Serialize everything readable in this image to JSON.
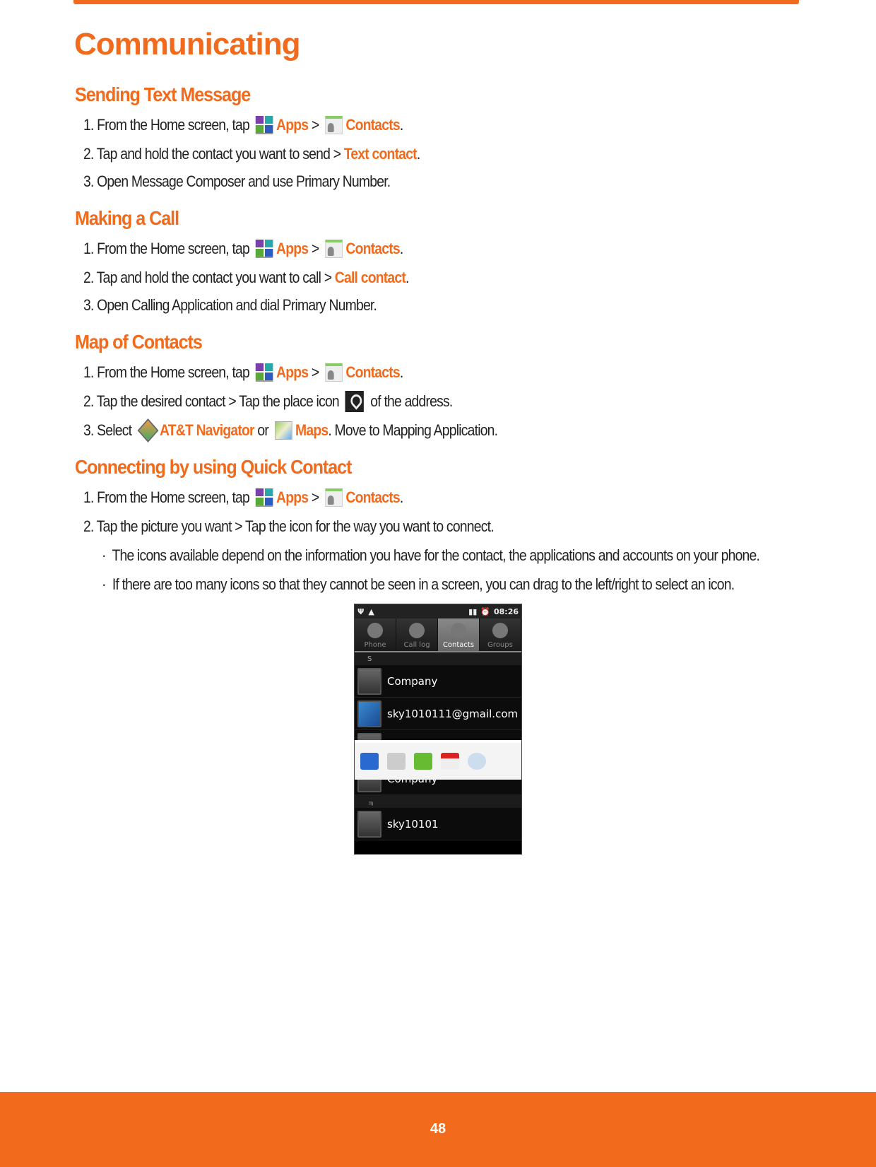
{
  "title": "Communicating",
  "sections": [
    {
      "heading": "Sending Text Message",
      "items": [
        [
          {
            "t": "1. From the Home screen, tap "
          },
          {
            "icon": "apps-icon"
          },
          {
            "t": "Apps",
            "link": true
          },
          {
            "t": " > "
          },
          {
            "icon": "contacts-icon"
          },
          {
            "t": "Contacts",
            "link": true
          },
          {
            "t": "."
          }
        ],
        [
          {
            "t": "2. Tap and hold the contact you want to send > "
          },
          {
            "t": "Text contact",
            "link": true
          },
          {
            "t": "."
          }
        ],
        [
          {
            "t": "3. Open Message Composer and use Primary Number."
          }
        ]
      ]
    },
    {
      "heading": "Making a Call",
      "items": [
        [
          {
            "t": "1. From the Home screen, tap "
          },
          {
            "icon": "apps-icon"
          },
          {
            "t": "Apps",
            "link": true
          },
          {
            "t": " > "
          },
          {
            "icon": "contacts-icon"
          },
          {
            "t": "Contacts",
            "link": true
          },
          {
            "t": "."
          }
        ],
        [
          {
            "t": "2. Tap and hold the contact you want to call > "
          },
          {
            "t": "Call contact",
            "link": true
          },
          {
            "t": "."
          }
        ],
        [
          {
            "t": "3. Open Calling Application and dial Primary Number."
          }
        ]
      ]
    },
    {
      "heading": "Map of Contacts",
      "items": [
        [
          {
            "t": "1. From the Home screen, tap "
          },
          {
            "icon": "apps-icon"
          },
          {
            "t": "Apps",
            "link": true
          },
          {
            "t": " > "
          },
          {
            "icon": "contacts-icon"
          },
          {
            "t": "Contacts",
            "link": true
          },
          {
            "t": "."
          }
        ],
        [
          {
            "t": "2. Tap the desired contact > Tap the place icon "
          },
          {
            "icon": "place-icon"
          },
          {
            "t": " of the address."
          }
        ],
        [
          {
            "t": "3. Select "
          },
          {
            "icon": "att-navigator-icon"
          },
          {
            "t": "AT&T Navigator",
            "link": true
          },
          {
            "t": " or "
          },
          {
            "icon": "maps-icon"
          },
          {
            "t": "Maps",
            "link": true
          },
          {
            "t": ". Move to Mapping Application."
          }
        ]
      ]
    },
    {
      "heading": "Connecting by using Quick Contact",
      "items": [
        [
          {
            "t": "1. From the Home screen, tap "
          },
          {
            "icon": "apps-icon"
          },
          {
            "t": "Apps",
            "link": true
          },
          {
            "t": " > "
          },
          {
            "icon": "contacts-icon"
          },
          {
            "t": "Contacts",
            "link": true
          },
          {
            "t": "."
          }
        ],
        [
          {
            "t": "2. Tap the picture you want > Tap the icon for the way you want to connect."
          }
        ],
        [
          {
            "t": "·  The icons available depend on the information you have for the contact, the applications and accounts on your phone."
          }
        ],
        [
          {
            "t": "·  If there are too many icons so that they cannot be seen in a screen, you can drag to the left/right to select an icon."
          }
        ]
      ]
    }
  ],
  "phone": {
    "time": "08:26",
    "tabs": [
      "Phone",
      "Call log",
      "Contacts",
      "Groups"
    ],
    "active_tab": "Contacts",
    "section_s": "S",
    "contacts": [
      "Company",
      "sky1010111@gmail.com",
      "Company",
      "sky10101"
    ],
    "section_k": "ㅋ"
  },
  "page_number": "48",
  "colors": {
    "accent": "#f26b1d"
  }
}
